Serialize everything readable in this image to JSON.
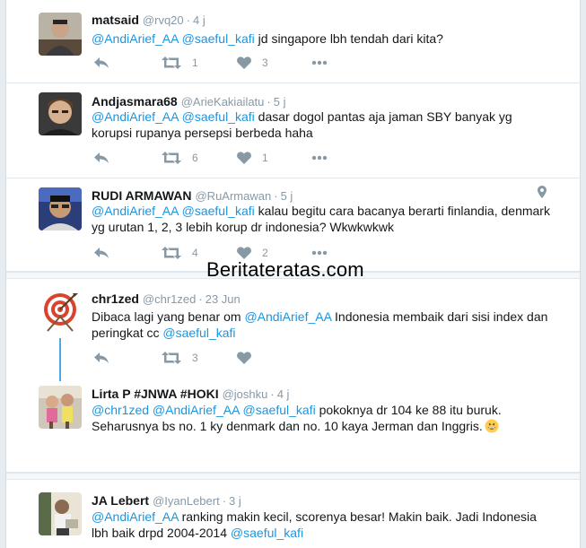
{
  "watermark": "Beritateratas.com",
  "colors": {
    "link": "#1b95e0",
    "thread": "#1b95e0",
    "muted": "#8899a6"
  },
  "tweets": [
    {
      "name": "matsaid",
      "handle": "@rvq20",
      "sep": "·",
      "time": "4 j",
      "mention1": "@AndiArief_AA",
      "mention2": "@saeful_kafi",
      "text_after": " jd singapore lbh tendah dari kita?",
      "retweets": "1",
      "likes": "3"
    },
    {
      "name": "Andjasmara68",
      "handle": "@ArieKakiailatu",
      "sep": "·",
      "time": "5 j",
      "mention1": "@AndiArief_AA",
      "mention2": "@saeful_kafi",
      "text_after": "  dasar dogol pantas aja jaman SBY banyak yg korupsi rupanya persepsi berbeda haha",
      "retweets": "6",
      "likes": "1"
    },
    {
      "name": "RUDI ARMAWAN",
      "handle": "@RuArmawan",
      "sep": "·",
      "time": "5 j",
      "mention1": "@AndiArief_AA",
      "mention2": "@saeful_kafi",
      "text_after": " kalau begitu cara bacanya berarti finlandia, denmark yg urutan 1, 2, 3 lebih korup dr indonesia? Wkwkwkwk",
      "retweets": "4",
      "likes": "2"
    },
    {
      "name": "chr1zed",
      "handle": "@chr1zed",
      "sep": "·",
      "time": "23 Jun",
      "text_before": "Dibaca lagi yang benar om ",
      "mention1": "@AndiArief_AA",
      "text_middle": " Indonesia membaik dari sisi index dan peringkat cc ",
      "mention2": "@saeful_kafi",
      "retweets": "3"
    },
    {
      "name": "Lirta P #JNWA #HOKI",
      "handle": "@joshku",
      "sep": "·",
      "time": "4 j",
      "mention1": "@chr1zed",
      "mention2": "@AndiArief_AA",
      "mention3": "@saeful_kafi",
      "text_after": " pokoknya dr 104 ke 88 itu buruk. Seharusnya bs no. 1 ky denmark dan no. 10 kaya Jerman dan Inggris."
    },
    {
      "name": "JA Lebert",
      "handle": "@IyanLebert",
      "sep": "·",
      "time": "3 j",
      "mention1": "@AndiArief_AA",
      "text_middle": " ranking makin kecil, scorenya besar! Makin baik. Jadi Indonesia lbh baik drpd 2004-2014 ",
      "mention2": "@saeful_kafi"
    }
  ]
}
